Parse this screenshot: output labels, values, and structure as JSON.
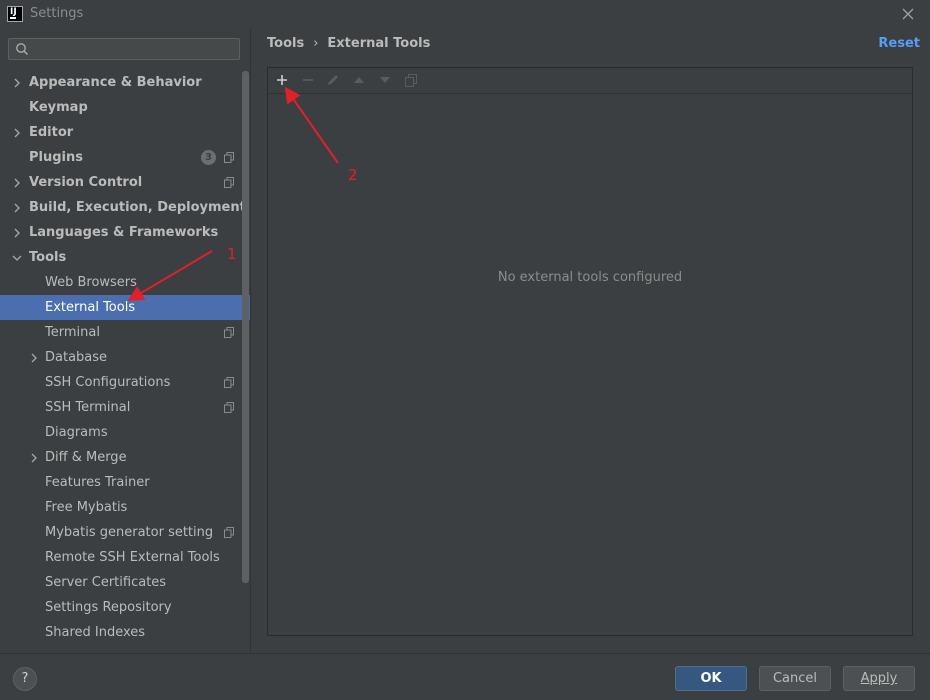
{
  "window": {
    "title": "Settings"
  },
  "search": {
    "placeholder": ""
  },
  "sidebar": {
    "items": [
      {
        "label": "Appearance & Behavior"
      },
      {
        "label": "Keymap"
      },
      {
        "label": "Editor"
      },
      {
        "label": "Plugins",
        "badge": "3"
      },
      {
        "label": "Version Control"
      },
      {
        "label": "Build, Execution, Deployment"
      },
      {
        "label": "Languages & Frameworks"
      },
      {
        "label": "Tools"
      },
      {
        "label": "Web Browsers"
      },
      {
        "label": "External Tools"
      },
      {
        "label": "Terminal"
      },
      {
        "label": "Database"
      },
      {
        "label": "SSH Configurations"
      },
      {
        "label": "SSH Terminal"
      },
      {
        "label": "Diagrams"
      },
      {
        "label": "Diff & Merge"
      },
      {
        "label": "Features Trainer"
      },
      {
        "label": "Free Mybatis"
      },
      {
        "label": "Mybatis generator setting"
      },
      {
        "label": "Remote SSH External Tools"
      },
      {
        "label": "Server Certificates"
      },
      {
        "label": "Settings Repository"
      },
      {
        "label": "Shared Indexes"
      }
    ]
  },
  "main": {
    "breadcrumb": [
      "Tools",
      "External Tools"
    ],
    "breadcrumb_separator": "›",
    "reset_label": "Reset",
    "empty_text": "No external tools configured"
  },
  "annotations": {
    "marker_1": "1",
    "marker_2": "2",
    "color": "#e0202a"
  },
  "footer": {
    "help_label": "?",
    "ok_label": "OK",
    "cancel_label": "Cancel",
    "apply_label": "Apply"
  },
  "colors": {
    "selection": "#4b6eaf",
    "link": "#589df6",
    "background": "#3c3f41"
  }
}
